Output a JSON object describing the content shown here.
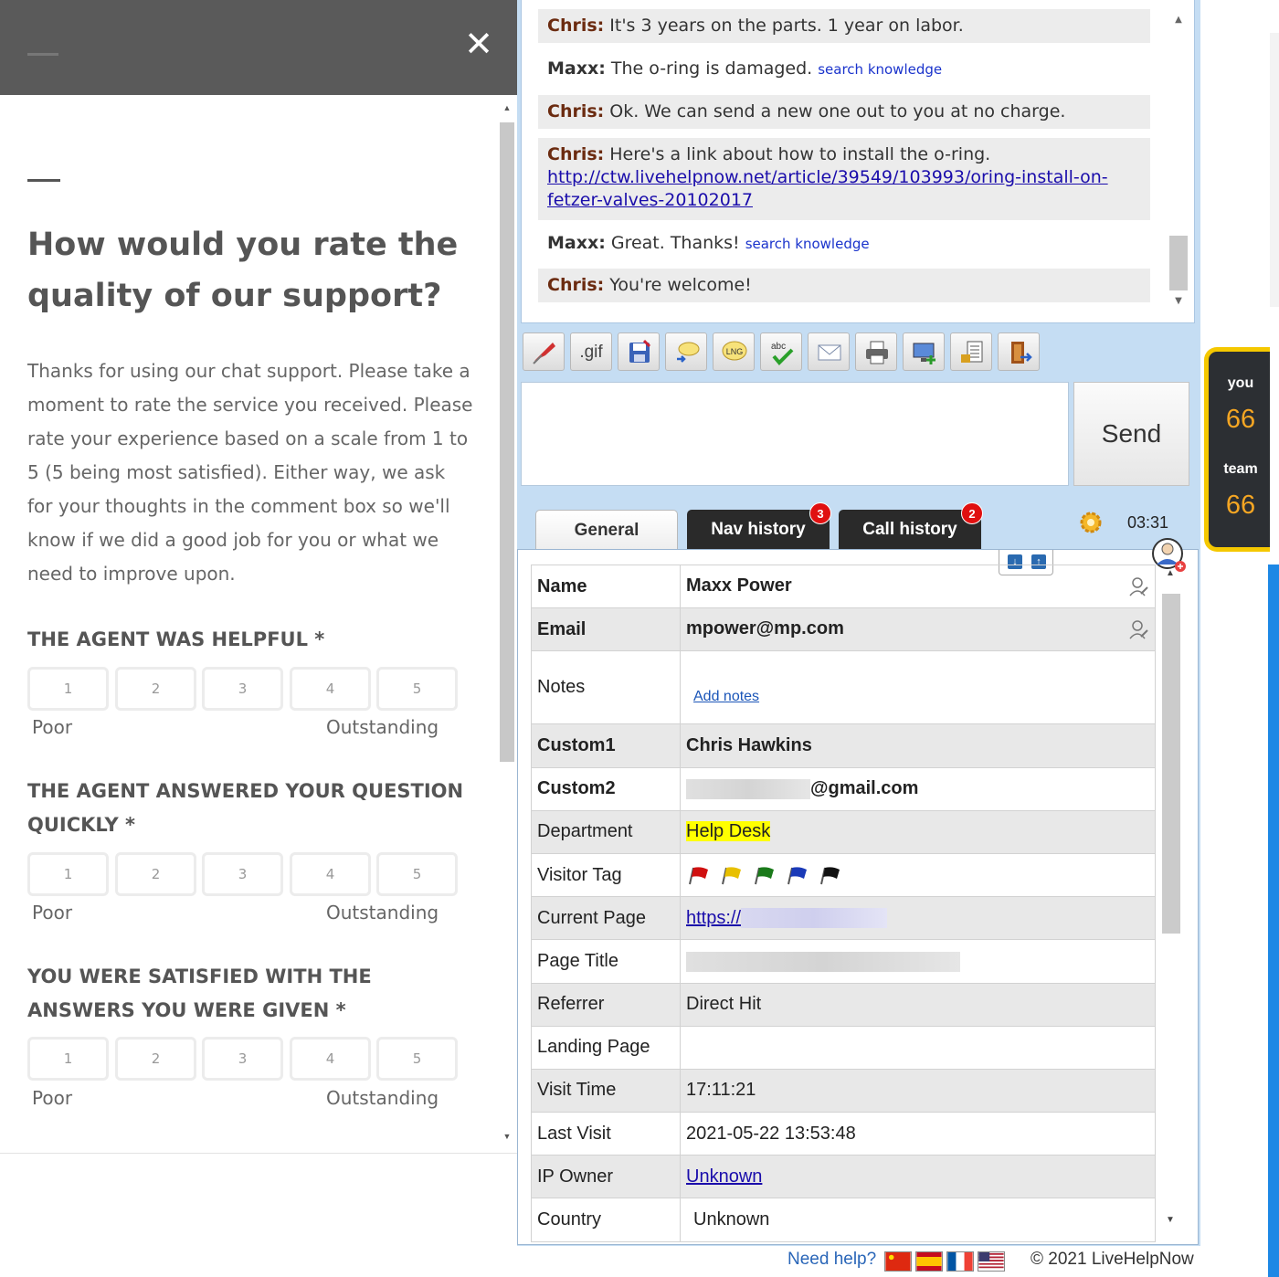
{
  "survey": {
    "close_glyph": "✕",
    "title": "How would you rate the quality of our support?",
    "intro": "Thanks for using our chat support. Please take a moment to rate the service you received. Please rate your experience based on a scale from 1 to 5 (5 being most satisfied). Either way, we ask for your thoughts in the comment box so we'll know if we did a good job for you or what we need to improve upon.",
    "questions": [
      {
        "label": "THE AGENT WAS HELPFUL *",
        "options": [
          "1",
          "2",
          "3",
          "4",
          "5"
        ],
        "low": "Poor",
        "high": "Outstanding"
      },
      {
        "label": "THE AGENT ANSWERED YOUR QUESTION QUICKLY *",
        "options": [
          "1",
          "2",
          "3",
          "4",
          "5"
        ],
        "low": "Poor",
        "high": "Outstanding"
      },
      {
        "label": "YOU WERE SATISFIED WITH THE ANSWERS YOU WERE GIVEN *",
        "options": [
          "1",
          "2",
          "3",
          "4",
          "5"
        ],
        "low": "Poor",
        "high": "Outstanding"
      }
    ]
  },
  "transcript": {
    "messages": [
      {
        "who": "Chris:",
        "text": "It's 3 years on the parts. 1 year on labor."
      },
      {
        "who": "Maxx:",
        "text": "The o-ring is damaged.",
        "action": "search knowledge"
      },
      {
        "who": "Chris:",
        "text": "Ok. We can send a new one out to you at no charge."
      },
      {
        "who": "Chris:",
        "text": "Here's a link about how to install the o-ring.",
        "link": "http://ctw.livehelpnow.net/article/39549/103993/oring-install-on-fetzer-valves-20102017"
      },
      {
        "who": "Maxx:",
        "text": "Great. Thanks!",
        "action": "search knowledge"
      },
      {
        "who": "Chris:",
        "text": "You're welcome!"
      }
    ]
  },
  "toolbar": {
    "gif_label": ".gif",
    "icons": [
      "pin-icon",
      "gif-icon",
      "save-icon",
      "canned-reply-icon",
      "language-icon",
      "spellcheck-icon",
      "email-icon",
      "print-icon",
      "screen-share-icon",
      "lock-icon",
      "end-chat-icon"
    ]
  },
  "composer": {
    "placeholder": "",
    "send_label": "Send"
  },
  "tabs": {
    "general": "General",
    "nav_history": "Nav history",
    "nav_badge": "3",
    "call_history": "Call history",
    "call_badge": "2",
    "timer": "03:31"
  },
  "visitor": {
    "name_label": "Name",
    "name": "Maxx Power",
    "email_label": "Email",
    "email": "mpower@mp.com",
    "notes_label": "Notes",
    "add_notes": "Add notes",
    "custom1_label": "Custom1",
    "custom1": "Chris Hawkins",
    "custom2_label": "Custom2",
    "custom2_visible": "@gmail.com",
    "department_label": "Department",
    "department": "Help Desk",
    "tag_label": "Visitor Tag",
    "tag_flags": [
      "red",
      "yellow",
      "green",
      "blue",
      "black"
    ],
    "current_page_label": "Current Page",
    "current_page": "https://",
    "page_title_label": "Page Title",
    "referrer_label": "Referrer",
    "referrer": "Direct Hit",
    "landing_page_label": "Landing Page",
    "visit_time_label": "Visit Time",
    "visit_time": "17:11:21",
    "last_visit_label": "Last Visit",
    "last_visit": "2021-05-22 13:53:48",
    "ip_owner_label": "IP Owner",
    "ip_owner": "Unknown",
    "country_label": "Country",
    "country": "Unknown"
  },
  "footer": {
    "need_help": "Need help?",
    "languages": [
      "chinese-flag",
      "spanish-flag",
      "french-flag",
      "us-flag"
    ],
    "copyright": "© 2021 LiveHelpNow"
  },
  "score": {
    "you_label": "you",
    "you_value": "66",
    "team_label": "team",
    "team_value": "66"
  },
  "colors": {
    "accent_yellow": "#f5c800",
    "score_orange": "#f5a623",
    "link_blue": "#1a0dab",
    "highlight": "#ffff00",
    "chat_bg": "#c5ddf3"
  }
}
